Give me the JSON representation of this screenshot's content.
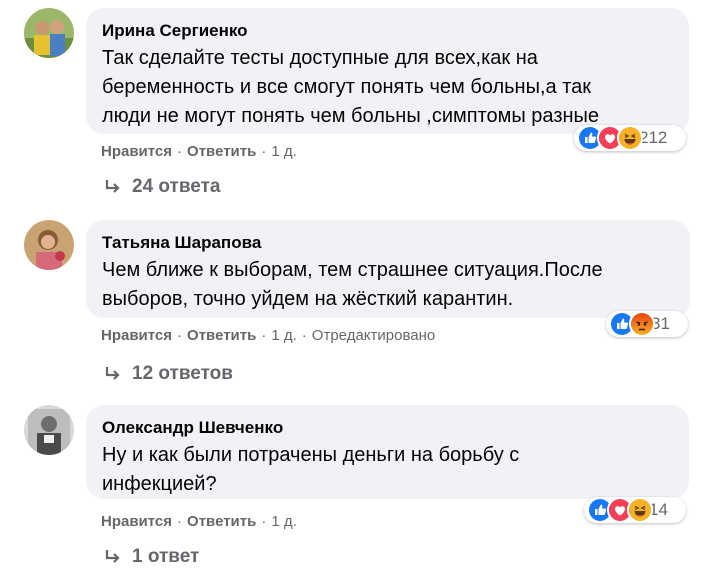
{
  "comments": [
    {
      "author": "Ирина Сергиенко",
      "lines": [
        "Так сделайте тесты доступные для всех,как на",
        "беременность и все смогут понять чем больны,а так",
        "люди не могут понять чем больны ,симптомы разные"
      ],
      "reactions": [
        "like",
        "love",
        "haha"
      ],
      "reaction_count": "212",
      "like": "Нравится",
      "reply": "Ответить",
      "time": "1 д.",
      "edited": "",
      "replies": "24 ответа"
    },
    {
      "author": "Татьяна Шарапова",
      "lines": [
        "Чем ближе к выборам, тем страшнее ситуация.После",
        "выборов, точно уйдем на жёсткий карантин."
      ],
      "reactions": [
        "like",
        "angry"
      ],
      "reaction_count": "31",
      "like": "Нравится",
      "reply": "Ответить",
      "time": "1 д.",
      "edited": "Отредактировано",
      "replies": "12 ответов"
    },
    {
      "author": "Олександр Шевченко",
      "lines": [
        "Ну и как были потрачены деньги на борьбу с",
        "инфекцией?"
      ],
      "reactions": [
        "like",
        "love",
        "haha"
      ],
      "reaction_count": "14",
      "like": "Нравится",
      "reply": "Ответить",
      "time": "1 д.",
      "edited": "",
      "replies": "1 ответ"
    }
  ],
  "colors": {
    "bubble": "#f0f2f5",
    "meta_text": "#65676b",
    "like": "#1877f2",
    "love": "#f33e58",
    "haha": "#f7b125",
    "angry": "#e9710f"
  },
  "separator": "·"
}
